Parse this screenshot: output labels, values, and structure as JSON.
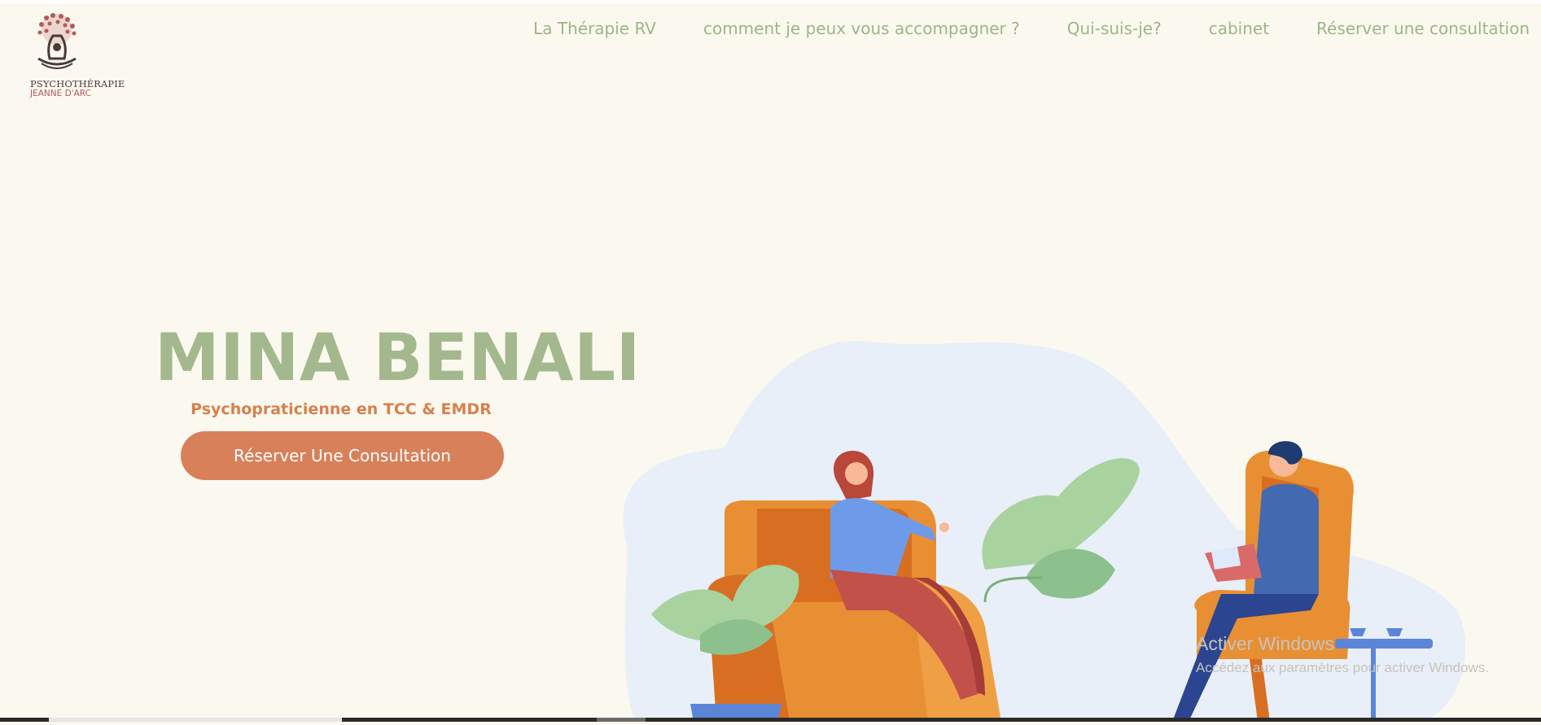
{
  "logo": {
    "line1": "PSYCHOTHÉRAPIE",
    "line2": "JEANNE D'ARC"
  },
  "nav": {
    "items": [
      "La Thérapie RV",
      "comment je peux vous accompagner ?",
      "Qui-suis-je?",
      "cabinet",
      "Réserver une consultation"
    ]
  },
  "hero": {
    "name": "MINA BENALI",
    "subtitle": "Psychopraticienne en TCC & EMDR",
    "cta_label": "Réserver Une Consultation"
  },
  "watermark": {
    "title": "Activer Windows",
    "subtitle": "Accédez aux paramètres pour activer Windows."
  },
  "colors": {
    "background": "#fbf9ef",
    "nav_text": "#9cb588",
    "name_text": "#a4b88d",
    "accent": "#d8805a"
  },
  "icons": {
    "logo": "tree-logo-icon",
    "illustration": "therapy-session-illustration"
  }
}
